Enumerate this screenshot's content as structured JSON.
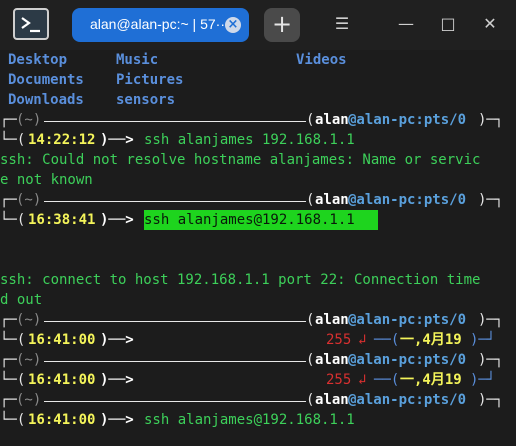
{
  "titlebar": {
    "tab_label": "alan@alan-pc:~ | 57··",
    "close_glyph": "×",
    "new_tab_glyph": "+",
    "menu_glyph": "☰",
    "minimize_glyph": "—",
    "maximize_glyph": "□",
    "close_window_glyph": "✕"
  },
  "ls": {
    "row1": [
      "Desktop",
      "Music",
      "Videos"
    ],
    "row2": [
      "Documents",
      "Pictures"
    ],
    "row3": [
      "Downloads",
      "sensors"
    ]
  },
  "prompt": {
    "tilde": "(~)",
    "user": "alan",
    "at_host": "@alan-pc:pts/0",
    "date": "一,4月19"
  },
  "blocks": [
    {
      "time": "14:22:12",
      "command": "ssh alanjames 192.168.1.1"
    },
    {
      "time": "16:38:41",
      "command": "ssh alanjames@192.168.1.1"
    },
    {
      "time": "16:41:00",
      "status": "255"
    },
    {
      "time": "16:41:00",
      "status": "255"
    },
    {
      "time": "16:41:00",
      "command": "ssh alanjames@192.168.1.1"
    }
  ],
  "output": {
    "err1_a": "ssh: Could not resolve hostname alanjames: Name or servic",
    "err1_b": "e not known",
    "err2_a": "ssh: connect to host 192.168.1.1 port 22: Connection time",
    "err2_b": "d out"
  }
}
